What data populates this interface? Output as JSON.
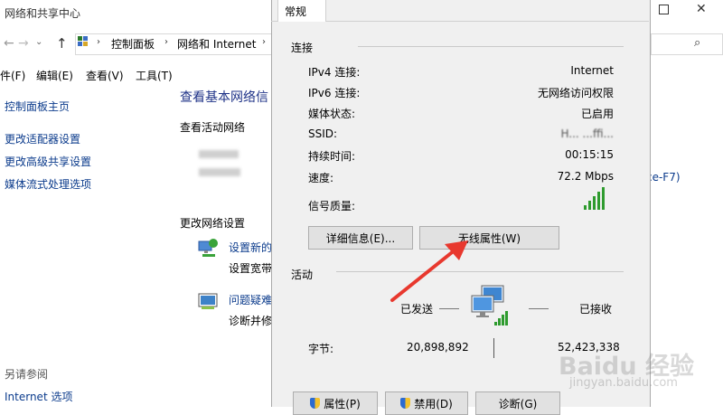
{
  "bg_window": {
    "title": "网络和共享中心",
    "breadcrumb": [
      "控制面板",
      "网络和 Internet"
    ],
    "menu": [
      "件(F)",
      "编辑(E)",
      "查看(V)",
      "工具(T)"
    ],
    "sidebar": [
      "控制面板主页",
      "更改适配器设置",
      "更改高级共享设置",
      "媒体流式处理选项"
    ],
    "see_also_title": "另请参阅",
    "see_also_items": [
      "Internet 选项"
    ],
    "main_title": "查看基本网络信",
    "active_networks_title": "查看活动网络",
    "change_settings_title": "更改网络设置",
    "item1_link": "设置新的",
    "item1_desc": "设置宽带",
    "item2_link": "问题疑难",
    "item2_desc": "诊断并修",
    "partial_text": "ce-F7)"
  },
  "dialog": {
    "tab": "常规",
    "connection_title": "连接",
    "rows": [
      {
        "label": "IPv4 连接:",
        "value": "Internet"
      },
      {
        "label": "IPv6 连接:",
        "value": "无网络访问权限"
      },
      {
        "label": "媒体状态:",
        "value": "已启用"
      },
      {
        "label": "SSID:",
        "value": "H...  ...ffi..."
      },
      {
        "label": "持续时间:",
        "value": "00:15:15"
      },
      {
        "label": "速度:",
        "value": "72.2 Mbps"
      }
    ],
    "signal_label": "信号质量:",
    "signal_level": 1.0,
    "details_button": "详细信息(E)...",
    "wireless_props_button": "无线属性(W)",
    "activity_title": "活动",
    "sent_label": "已发送",
    "received_label": "已接收",
    "bytes_label": "字节:",
    "bytes_sent": "20,898,892",
    "bytes_received": "52,423,338",
    "properties_button": "属性(P)",
    "disable_button": "禁用(D)",
    "diagnose_button": "诊断(G)"
  },
  "watermark": {
    "logo": "Baidu 经验",
    "url": "jingyan.baidu.com"
  },
  "colors": {
    "link": "#0b3b8c",
    "arrow": "#e8382e",
    "signal": "#2e9b2e",
    "focus": "#0078d7"
  }
}
